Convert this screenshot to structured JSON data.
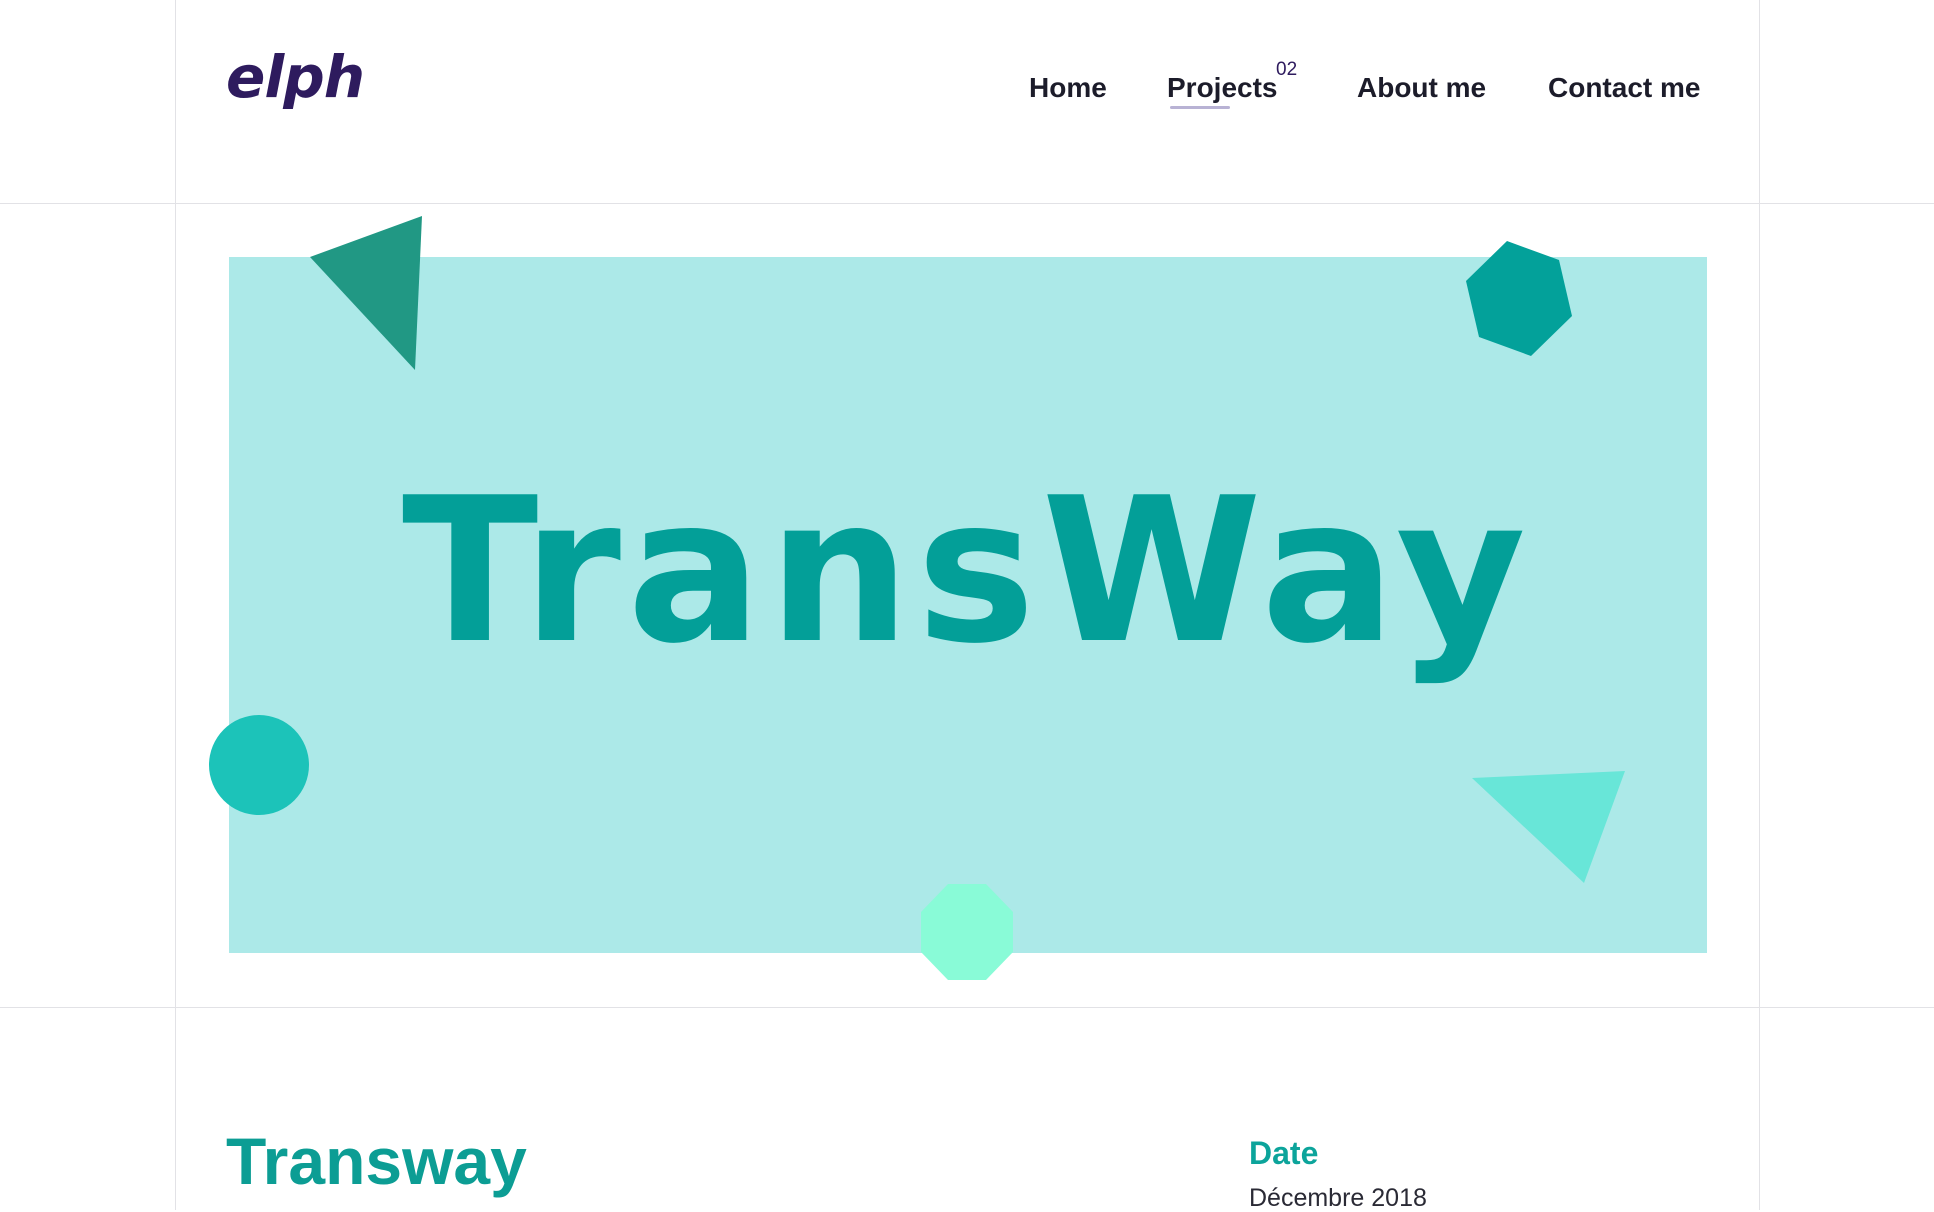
{
  "header": {
    "logo": "elph",
    "nav": [
      {
        "label": "Home"
      },
      {
        "label": "Projects",
        "count": "02",
        "active": true
      },
      {
        "label": "About me"
      },
      {
        "label": "Contact me"
      }
    ]
  },
  "hero": {
    "title": "TransWay",
    "background_color": "#ace9e8",
    "shapes": [
      {
        "name": "triangle",
        "color": "#219884"
      },
      {
        "name": "hexagon",
        "color": "#03a19a"
      },
      {
        "name": "circle",
        "color": "#1cc3b9"
      },
      {
        "name": "triangle",
        "color": "#68e6d8"
      },
      {
        "name": "octagon",
        "color": "#89fbd7"
      }
    ]
  },
  "project": {
    "title": "Transway",
    "meta": [
      {
        "label": "Date",
        "value": "Décembre 2018"
      }
    ]
  },
  "colors": {
    "accent": "#0c9d94",
    "logo": "#2e1b5e"
  }
}
